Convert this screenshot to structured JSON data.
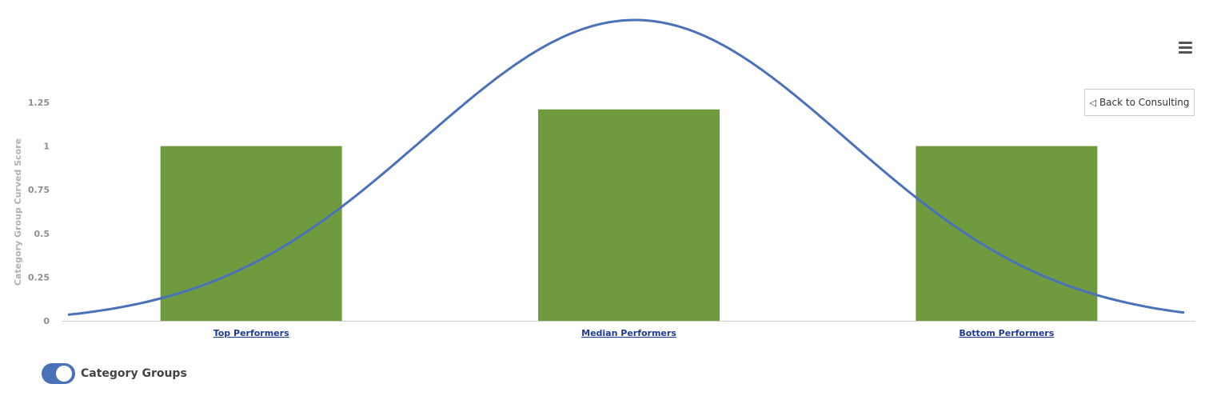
{
  "chart_data": {
    "type": "bar",
    "categories": [
      "Top Performers",
      "Median Performers",
      "Bottom Performers"
    ],
    "values": [
      1.0,
      1.21,
      1.0
    ],
    "bar_color": "#709a3e",
    "curve_color": "#4a72b8",
    "title": "",
    "xlabel": "",
    "ylabel": "Category Group Curved Score",
    "yticks": [
      "0",
      "0.25",
      "0.5",
      "0.75",
      "1",
      "1.25"
    ],
    "ylim": [
      0,
      1.25
    ],
    "overlay": {
      "type": "line",
      "shape": "bell-curve"
    }
  },
  "menu": {
    "icon": "hamburger-menu-icon"
  },
  "back_button": {
    "label": "Back to Consulting",
    "icon": "chevron-left-icon"
  },
  "toggle": {
    "label": "Category Groups",
    "state": "on",
    "color": "#4a72b8"
  }
}
